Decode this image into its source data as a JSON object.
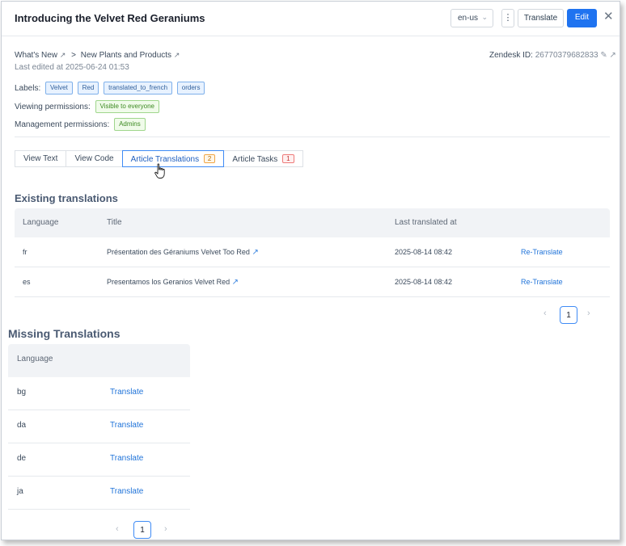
{
  "header": {
    "title": "Introducing the Velvet Red Geraniums",
    "locale": "en-us",
    "more_glyph": "⋮",
    "translate_label": "Translate",
    "edit_label": "Edit",
    "close_glyph": "✕"
  },
  "meta": {
    "breadcrumb": [
      "What's New",
      ">",
      "New Plants and Products"
    ],
    "last_edited": "Last edited at 2025-06-24 01:53",
    "zendesk_label": "Zendesk ID:",
    "zendesk_id": "26770379682833",
    "labels_label": "Labels:",
    "labels": [
      "Velvet",
      "Red",
      "translated_to_french",
      "orders"
    ],
    "viewing_label": "Viewing permissions:",
    "viewing_value": "Visible to everyone",
    "management_label": "Management permissions:",
    "management_value": "Admins"
  },
  "tabs": [
    {
      "label": "View Text",
      "count": null
    },
    {
      "label": "View Code",
      "count": null
    },
    {
      "label": "Article Translations",
      "count": "2",
      "active": true
    },
    {
      "label": "Article Tasks",
      "count": "1"
    }
  ],
  "existing": {
    "heading": "Existing translations",
    "columns": [
      "Language",
      "Title",
      "Last translated at"
    ],
    "rows": [
      {
        "lang": "fr",
        "title": "Présentation des Géraniums Velvet Too Red",
        "date": "2025-08-14 08:42",
        "action": "Re-Translate"
      },
      {
        "lang": "es",
        "title": "Presentamos los Geranios Velvet Red",
        "date": "2025-08-14 08:42",
        "action": "Re-Translate"
      }
    ],
    "page": "1"
  },
  "missing": {
    "heading": "Missing Translations",
    "columns": [
      "Language"
    ],
    "rows": [
      {
        "lang": "bg",
        "action": "Translate"
      },
      {
        "lang": "da",
        "action": "Translate"
      },
      {
        "lang": "de",
        "action": "Translate"
      },
      {
        "lang": "ja",
        "action": "Translate"
      }
    ],
    "page": "1"
  },
  "pager": {
    "prev_glyph": "‹",
    "next_glyph": "›"
  },
  "colors": {
    "accent": "#1f73f0",
    "link": "#1f73d9",
    "heading": "#4a5a72"
  }
}
